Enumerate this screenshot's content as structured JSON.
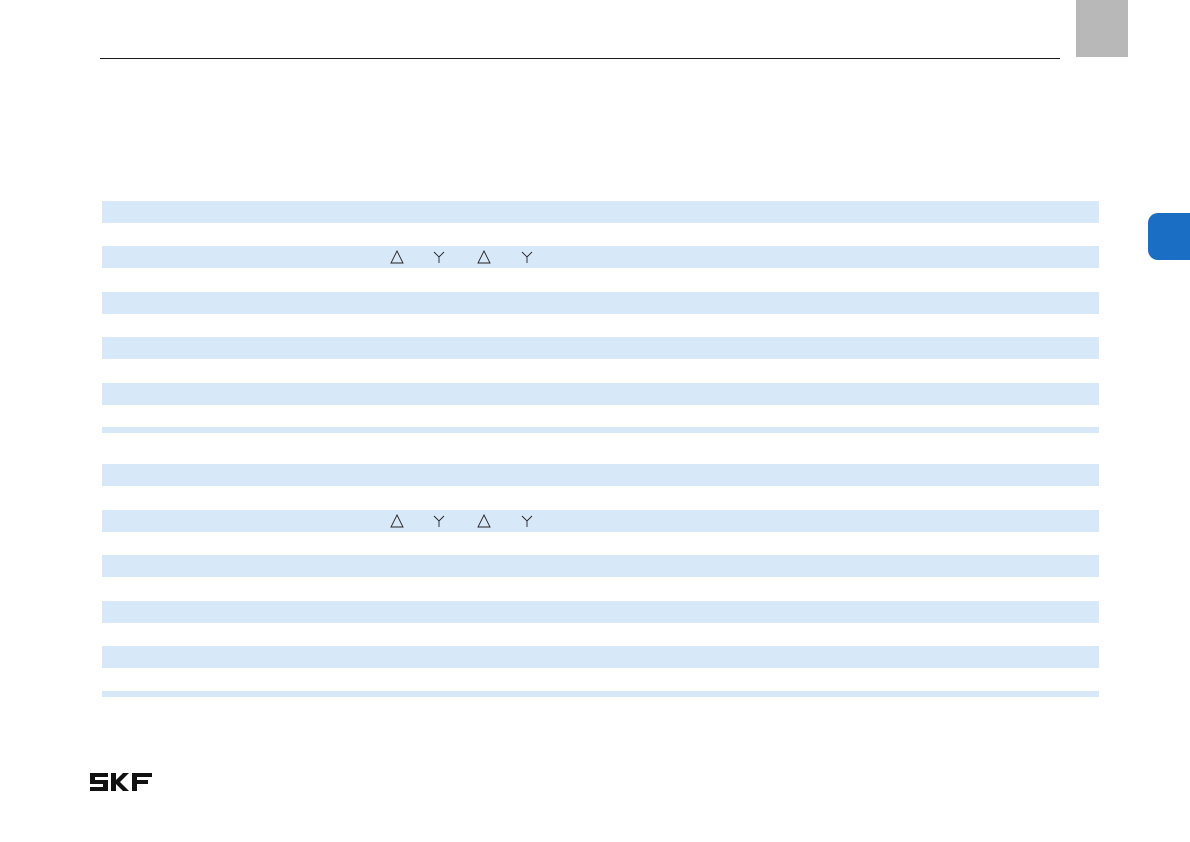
{
  "page": {
    "logo_text": "SKF",
    "colors": {
      "row_shade": "#d7e8f8",
      "section_tab": "#1a6fc4",
      "corner_tab": "#b8b8b8",
      "rule": "#1a1a1a"
    }
  },
  "table_top": {
    "symbols": [
      "delta-icon",
      "wye-icon",
      "delta-icon",
      "wye-icon"
    ]
  },
  "table_bottom": {
    "symbols": [
      "delta-icon",
      "wye-icon",
      "delta-icon",
      "wye-icon"
    ]
  }
}
